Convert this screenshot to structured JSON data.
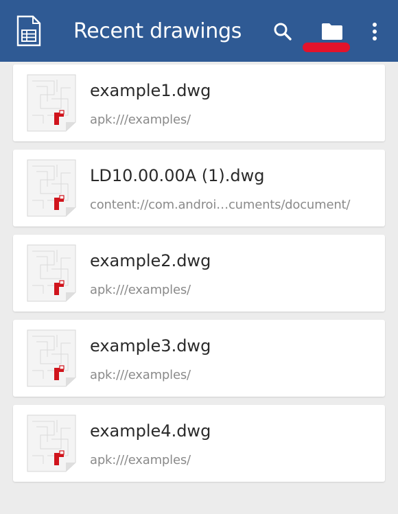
{
  "appbar": {
    "title": "Recent drawings",
    "app_icon": "drawing-document-icon",
    "actions": [
      {
        "name": "search-icon"
      },
      {
        "name": "folder-icon"
      },
      {
        "name": "more-vert-icon"
      }
    ],
    "background_color": "#2f5a94",
    "highlight_color": "#e3132b"
  },
  "files": [
    {
      "name": "example1.dwg",
      "path": "apk:///examples/"
    },
    {
      "name": "LD10.00.00A (1).dwg",
      "path": "content://com.androi…cuments/document/"
    },
    {
      "name": "example2.dwg",
      "path": "apk:///examples/"
    },
    {
      "name": "example3.dwg",
      "path": "apk:///examples/"
    },
    {
      "name": "example4.dwg",
      "path": "apk:///examples/"
    }
  ],
  "file_thumbnail_icon": "dwg-file-icon",
  "accent_color": "#d0141c"
}
